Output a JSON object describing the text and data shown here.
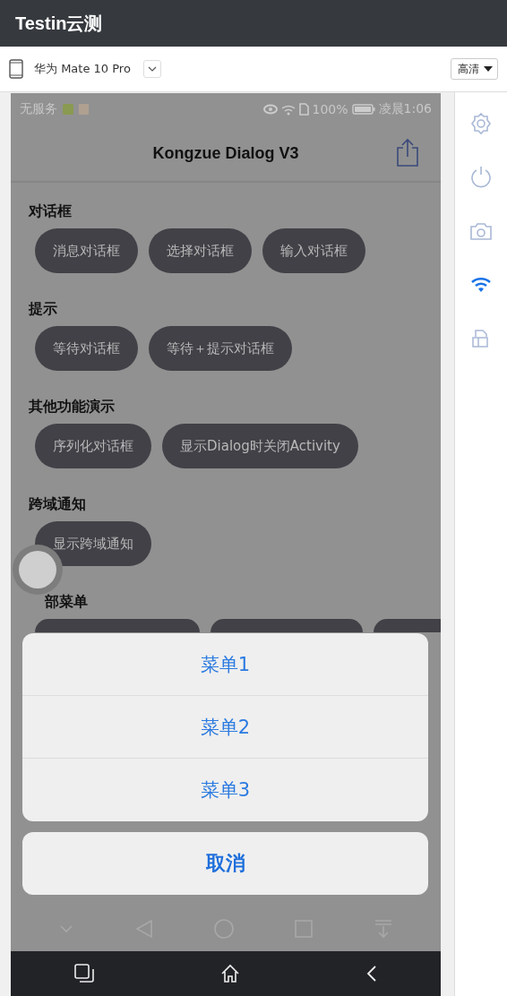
{
  "header": {
    "logo": "Testin云测"
  },
  "toolbar": {
    "device": "华为 Mate 10 Pro",
    "quality": "高清"
  },
  "status_bar": {
    "carrier": "无服务",
    "battery": "100%",
    "time": "凌晨1:06"
  },
  "app_bar": {
    "title": "Kongzue Dialog V3"
  },
  "sections": [
    {
      "title": "对话框",
      "buttons": [
        "消息对话框",
        "选择对话框",
        "输入对话框"
      ]
    },
    {
      "title": "提示",
      "buttons": [
        "等待对话框",
        "等待＋提示对话框"
      ]
    },
    {
      "title": "其他功能演示",
      "buttons": [
        "序列化对话框",
        "显示Dialog时关闭Activity"
      ]
    },
    {
      "title": "跨域通知",
      "buttons": [
        "显示跨域通知"
      ]
    },
    {
      "title": "部菜单"
    }
  ],
  "bottom_sheet": {
    "items": [
      "菜单1",
      "菜单2",
      "菜单3"
    ],
    "cancel": "取消"
  },
  "sidebar": {
    "tools": [
      {
        "kind": "settings",
        "selected": false
      },
      {
        "kind": "power",
        "selected": false
      },
      {
        "kind": "camera",
        "selected": false
      },
      {
        "kind": "wifi",
        "selected": true
      },
      {
        "kind": "rotate",
        "selected": false
      }
    ]
  }
}
